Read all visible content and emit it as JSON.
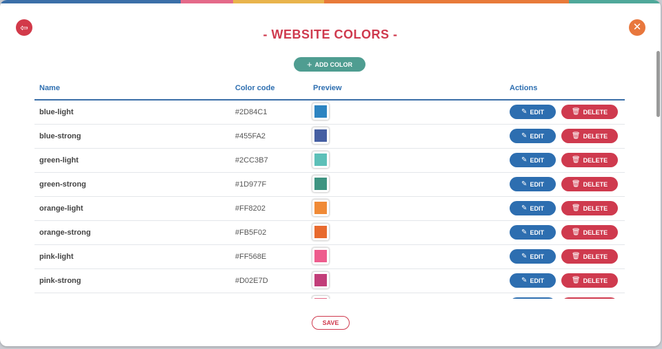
{
  "top_bar_colors": [
    "#3b6fa8",
    "#e46a8a",
    "#e9b44c",
    "#e87a3a",
    "#4fa89a"
  ],
  "header": {
    "back_icon": "⇦",
    "close_icon": "✕",
    "title": "- WEBSITE COLORS -"
  },
  "add_button": {
    "icon": "+",
    "label": "ADD COLOR"
  },
  "table": {
    "columns": [
      "Name",
      "Color code",
      "Preview",
      "Actions"
    ],
    "rows": [
      {
        "name": "blue-light",
        "code": "#2D84C1",
        "color": "#2D84C1"
      },
      {
        "name": "blue-strong",
        "code": "#455FA2",
        "color": "#455FA2"
      },
      {
        "name": "green-light",
        "code": "#2CC3B7",
        "color": "#5DC0B8"
      },
      {
        "name": "green-strong",
        "code": "#1D977F",
        "color": "#3E9481"
      },
      {
        "name": "orange-light",
        "code": "#FF8202",
        "color": "#F08A36"
      },
      {
        "name": "orange-strong",
        "code": "#FB5F02",
        "color": "#E86A2E"
      },
      {
        "name": "pink-light",
        "code": "#FF568E",
        "color": "#EE5C8D"
      },
      {
        "name": "pink-strong",
        "code": "#D02E7D",
        "color": "#C23E79"
      },
      {
        "name": "",
        "code": "",
        "color": "#E56A86"
      }
    ],
    "edit_label": "EDIT",
    "delete_label": "DELETE",
    "edit_icon": "✎",
    "delete_icon": "🗑"
  },
  "save_button": {
    "label": "SAVE"
  }
}
